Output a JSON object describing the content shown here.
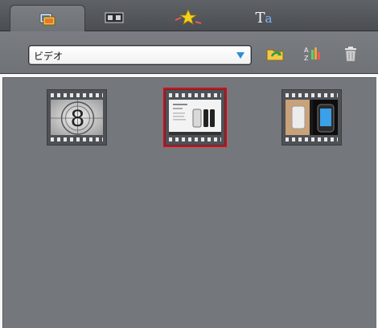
{
  "colors": {
    "selection": "#e60012",
    "dropdown_arrow": "#2a8fd8",
    "media_background": "#74777c"
  },
  "tabs": [
    {
      "icon": "media-library-icon",
      "active": true
    },
    {
      "icon": "transitions-icon",
      "active": false
    },
    {
      "icon": "effects-icon",
      "active": false
    },
    {
      "icon": "text-icon",
      "label": "Ta",
      "active": false
    }
  ],
  "toolbar": {
    "folder_select_value": "ビデオ",
    "import_icon": "folder-import-icon",
    "sort_icon": "sort-az-icon",
    "delete_icon": "trash-icon"
  },
  "media": [
    {
      "name": "countdown",
      "icon": "countdown-8-icon",
      "number": "8",
      "selected": false
    },
    {
      "name": "product-video",
      "icon": "product-video-icon",
      "selected": true
    },
    {
      "name": "phone-video",
      "icon": "phone-video-icon",
      "selected": false
    }
  ]
}
